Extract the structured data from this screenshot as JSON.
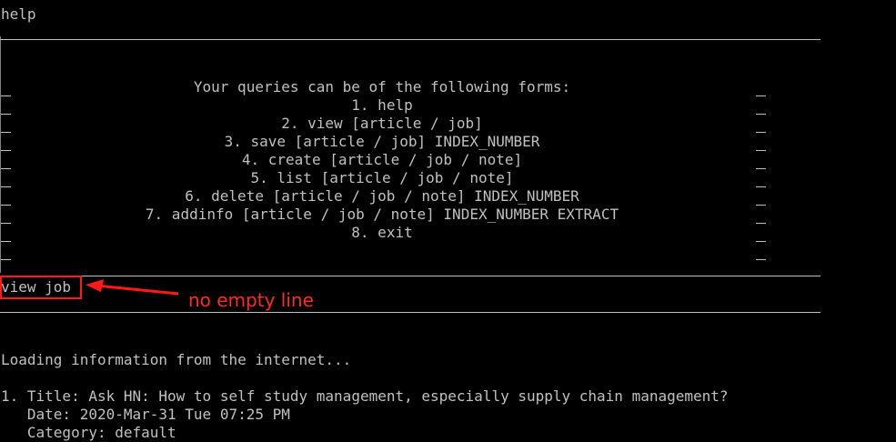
{
  "terminal": {
    "command_help": "help",
    "menu": {
      "heading": "Your queries can be of the following forms:",
      "items": [
        "1. help",
        "2. view [article / job]",
        "3. save [article / job] INDEX_NUMBER",
        "4. create [article / job / note]",
        "5. list [article / job / note]",
        "6. delete [article / job / note] INDEX_NUMBER",
        "7. addinfo [article / job / note] INDEX_NUMBER EXTRACT",
        "8. exit"
      ]
    },
    "command_view": "view job",
    "loading": "Loading information from the internet...",
    "result": {
      "title_line": "1. Title: Ask HN: How to self study management, especially supply chain management?",
      "date_line": "   Date: 2020-Mar-31 Tue 07:25 PM",
      "category_line": "   Category: default"
    }
  },
  "annotation": {
    "text": "no empty line",
    "color": "#ff2a2a"
  }
}
